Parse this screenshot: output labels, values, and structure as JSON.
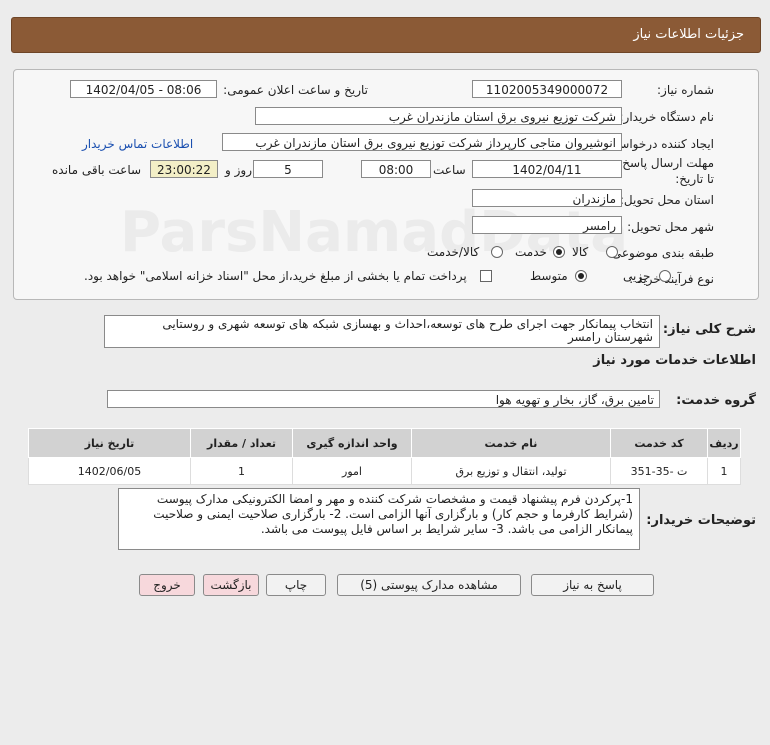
{
  "header": {
    "title": "جزئیات اطلاعات نیاز"
  },
  "form": {
    "need_number_label": "شماره نیاز:",
    "need_number": "1102005349000072",
    "announce_label": "تاریخ و ساعت اعلان عمومی:",
    "announce_value": "1402/04/05 - 08:06",
    "buyer_org_label": "نام دستگاه خریدار:",
    "buyer_org": "شرکت توزیع نیروی برق استان مازندران غرب",
    "requester_label": "ایجاد کننده درخواست:",
    "requester": "انوشیروان متاجی کارپرداز شرکت توزیع نیروی برق استان مازندران غرب",
    "contact_link": "اطلاعات تماس خریدار",
    "deadline_label": "مهلت ارسال پاسخ: تا تاریخ:",
    "deadline_date": "1402/04/11",
    "time_label": "ساعت",
    "deadline_time": "08:00",
    "days_value": "5",
    "days_label": "روز و",
    "remaining_time": "23:00:22",
    "remaining_label": "ساعت باقی مانده",
    "province_label": "استان محل تحویل:",
    "province": "مازندران",
    "city_label": "شهر محل تحویل:",
    "city": "رامسر",
    "category_label": "طبقه بندی موضوعی:",
    "category_options": [
      "کالا",
      "خدمت",
      "کالا/خدمت"
    ],
    "category_selected": "خدمت",
    "process_label": "نوع فرآیند خرید :",
    "process_options": [
      "جزیی",
      "متوسط"
    ],
    "process_selected": "متوسط",
    "payment_note": "پرداخت تمام یا بخشی از مبلغ خرید،از محل \"اسناد خزانه اسلامی\" خواهد بود."
  },
  "summary": {
    "label": "شرح کلی نیاز:",
    "text": "انتخاب پیمانکار جهت اجرای طرح های توسعه،احداث و بهسازی شبکه های توسعه شهری و روستایی شهرستان رامسر"
  },
  "services": {
    "section_title": "اطلاعات خدمات مورد نیاز",
    "group_label": "گروه خدمت:",
    "group_value": "تامین برق، گاز، بخار و تهویه هوا",
    "table": {
      "headers": [
        "ردیف",
        "کد خدمت",
        "نام خدمت",
        "واحد اندازه گیری",
        "تعداد / مقدار",
        "تاریخ نیاز"
      ],
      "rows": [
        [
          "1",
          "ت -35-351",
          "تولید، انتقال و توزیع برق",
          "امور",
          "1",
          "1402/06/05"
        ]
      ]
    }
  },
  "buyer_notes": {
    "label": "توضیحات خریدار:",
    "text": "1-پرکردن فرم پیشنهاد قیمت و مشخصات شرکت کننده و مهر و امضا الکترونیکی مدارک پیوست (شرایط کارفرما و حجم کار) و بارگزاری آنها الزامی است. 2- بارگزاری صلاحیت ایمنی و صلاحیت پیمانکار الزامی می باشد. 3- سایر شرایط بر اساس فایل پیوست می باشد."
  },
  "buttons": {
    "reply": "پاسخ به نیاز",
    "attachments": "مشاهده مدارک پیوستی (5)",
    "print": "چاپ",
    "back": "بازگشت",
    "exit": "خروج"
  }
}
